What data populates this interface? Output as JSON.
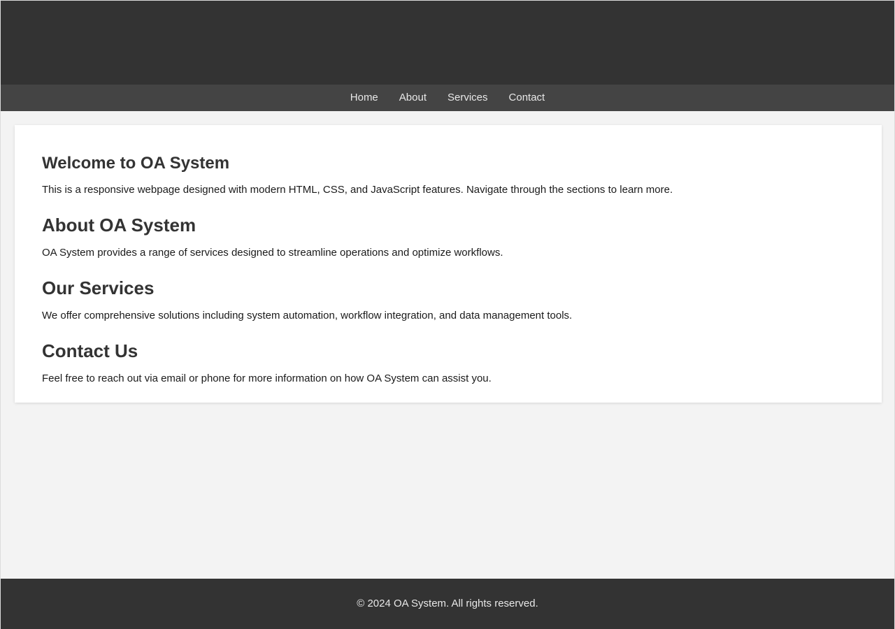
{
  "header": {
    "brand": ""
  },
  "nav": {
    "items": [
      {
        "label": "Home"
      },
      {
        "label": "About"
      },
      {
        "label": "Services"
      },
      {
        "label": "Contact"
      }
    ]
  },
  "main": {
    "sections": [
      {
        "id": "welcome",
        "heading": "Welcome to OA System",
        "body": "This is a responsive webpage designed with modern HTML, CSS, and JavaScript features. Navigate through the sections to learn more."
      },
      {
        "id": "about",
        "heading": "About OA System",
        "body": "OA System provides a range of services designed to streamline operations and optimize workflows."
      },
      {
        "id": "services",
        "heading": "Our Services",
        "body": "We offer comprehensive solutions including system automation, workflow integration, and data management tools."
      },
      {
        "id": "contact",
        "heading": "Contact Us",
        "body": "Feel free to reach out via email or phone for more information on how OA System can assist you."
      }
    ]
  },
  "footer": {
    "copyright": "© 2024 OA System. All rights reserved."
  },
  "colors": {
    "header_bg": "#333333",
    "nav_bg": "#444444",
    "page_bg": "#f3f3f3",
    "card_bg": "#ffffff",
    "heading_text": "#333333",
    "body_text": "#1a1a1a",
    "nav_text": "#e8e8e8",
    "footer_bg": "#333333",
    "footer_text": "#e8e8e8"
  }
}
